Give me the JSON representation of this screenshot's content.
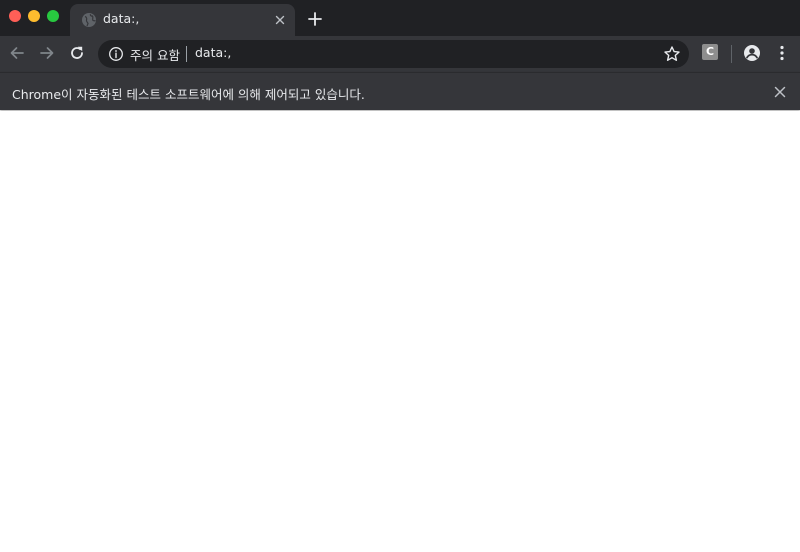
{
  "window": {
    "controls": [
      "close",
      "minimize",
      "zoom"
    ]
  },
  "tab": {
    "title": "data:,",
    "favicon": "globe-icon",
    "close_icon": "close-icon"
  },
  "new_tab": {
    "icon": "plus-icon"
  },
  "toolbar": {
    "back_icon": "arrow-left-icon",
    "forward_icon": "arrow-right-icon",
    "reload_icon": "reload-icon",
    "omnibox": {
      "security_icon": "info-icon",
      "security_text": "주의 요함",
      "url": "data:,",
      "bookmark_icon": "star-icon"
    },
    "extension_label": "C",
    "profile_icon": "account-circle-icon",
    "menu_icon": "more-vert-icon"
  },
  "infobar": {
    "message": "Chrome이 자동화된 테스트 소프트웨어에 의해 제어되고 있습니다.",
    "close_icon": "close-icon"
  },
  "colors": {
    "tabstrip_bg": "#202124",
    "toolbar_bg": "#35363a",
    "omnibox_bg": "#202124",
    "text": "#e8eaed",
    "icon_disabled": "#80868b",
    "page_bg": "#ffffff"
  }
}
